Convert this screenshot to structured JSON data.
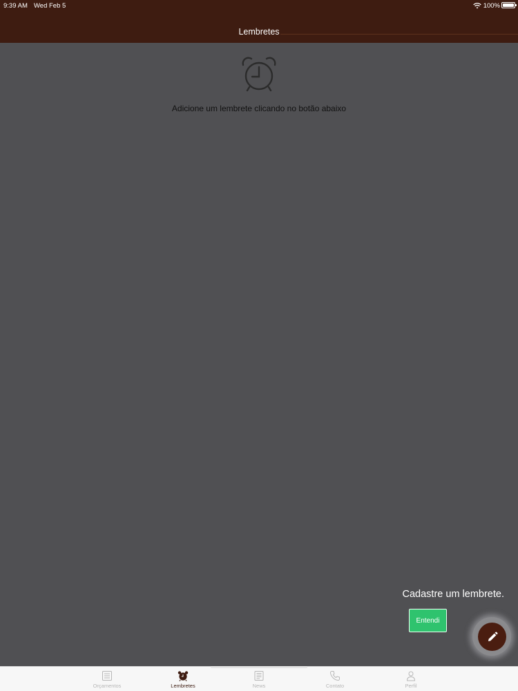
{
  "status_bar": {
    "time": "9:39 AM",
    "date": "Wed Feb 5",
    "battery": "100%"
  },
  "header": {
    "title": "Lembretes"
  },
  "empty_state": {
    "icon": "alarm-clock-icon",
    "message": "Adicione um lembrete clicando no botão abaixo"
  },
  "tooltip": {
    "message": "Cadastre um lembrete.",
    "button_label": "Entendi"
  },
  "fab": {
    "icon": "pencil-icon"
  },
  "tabbar": {
    "items": [
      {
        "label": "Orçamentos",
        "icon": "list-icon"
      },
      {
        "label": "Lembretes",
        "icon": "alarm-clock-icon"
      },
      {
        "label": "News",
        "icon": "newspaper-icon"
      },
      {
        "label": "Contato",
        "icon": "phone-icon"
      },
      {
        "label": "Perfil",
        "icon": "user-icon"
      }
    ],
    "active_index": 1
  },
  "colors": {
    "header": "#3e1c11",
    "overlay": "#505053",
    "accent_green": "#2fc36e",
    "fab": "#4a1d10",
    "tab_active": "#3e1c11",
    "tab_inactive": "#b7b7b7"
  }
}
